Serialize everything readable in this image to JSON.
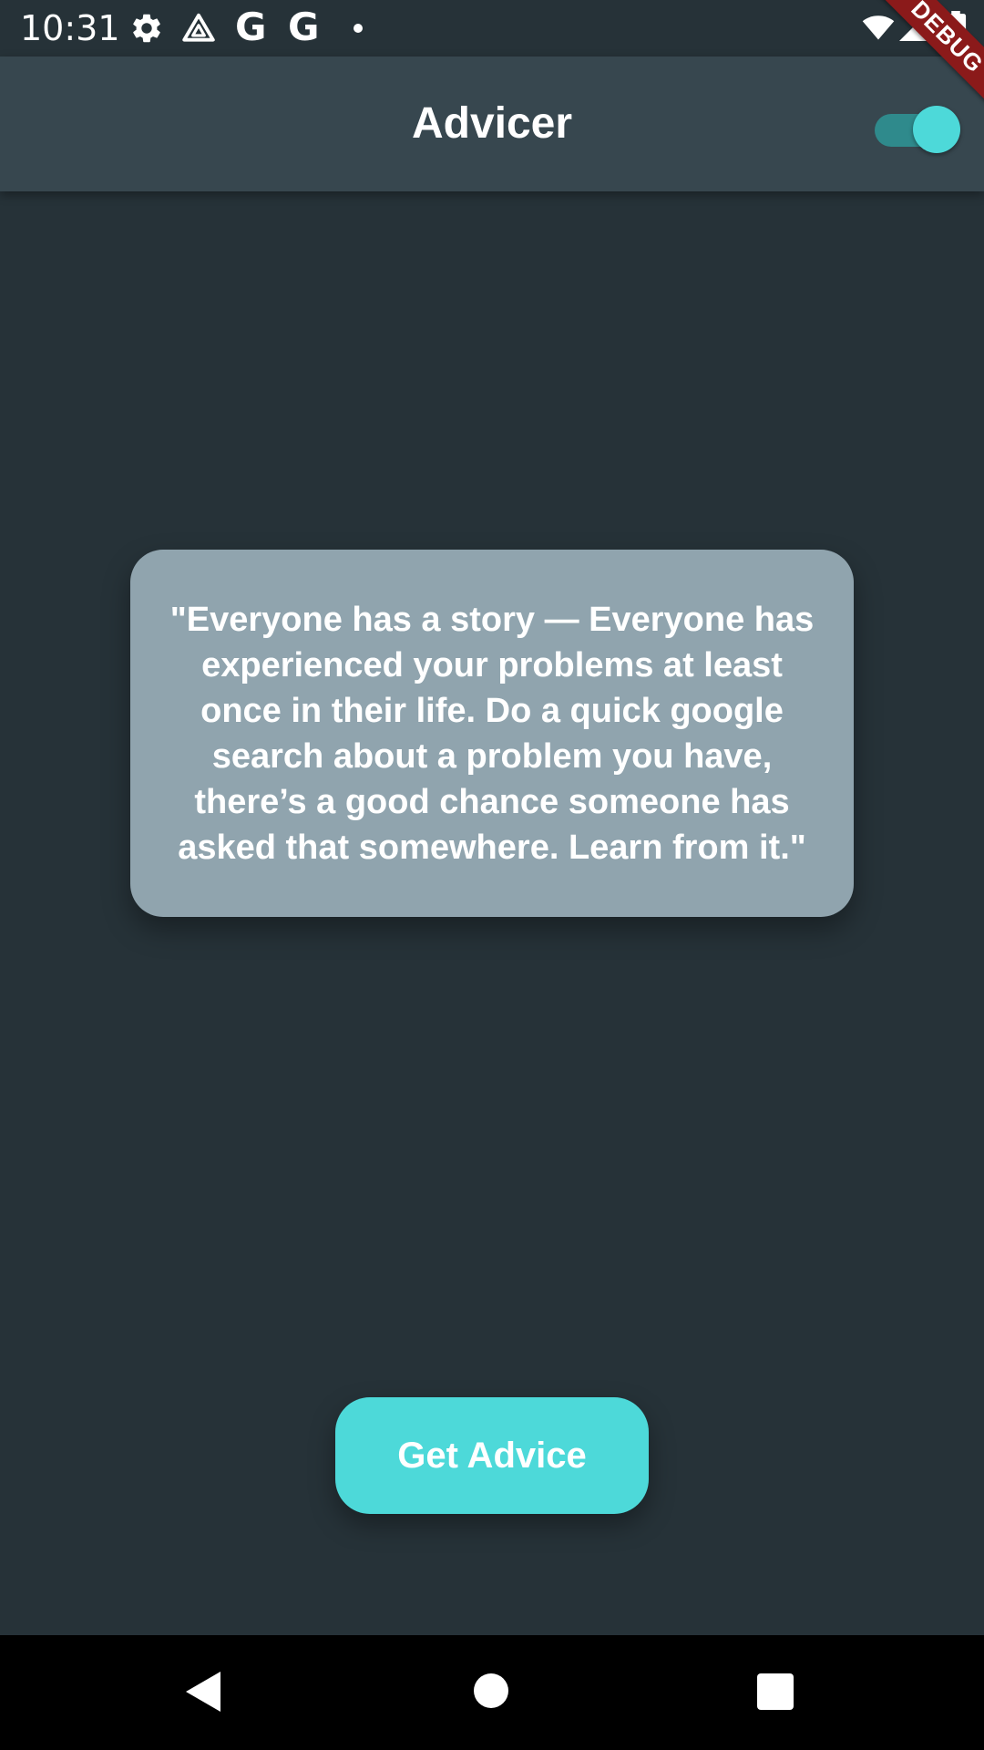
{
  "status_bar": {
    "time": "10:31",
    "icons": [
      "gear-icon",
      "drive-icon",
      "google-icon",
      "google-icon",
      "dot-icon",
      "wifi-icon",
      "signal-icon",
      "battery-icon"
    ],
    "google_letter": "G"
  },
  "app_bar": {
    "title": "Advicer",
    "toggle_on": true
  },
  "debug_banner": {
    "label": "DEBUG"
  },
  "advice": {
    "text": "\"Everyone has a story — Everyone has experienced your problems at least once in their life. Do a quick google search about a problem you have, there’s a good chance someone has asked that somewhere. Learn from it.\""
  },
  "button": {
    "label": "Get Advice"
  },
  "nav_bar": {
    "icons": [
      "back-icon",
      "home-icon",
      "recents-icon"
    ]
  },
  "colors": {
    "background": "#263238",
    "app_bar": "#37474f",
    "card": "#90a4ae",
    "accent": "#4dd9d9",
    "toggle_track": "#2f8a8c",
    "debug_banner": "#8b1a1a"
  }
}
